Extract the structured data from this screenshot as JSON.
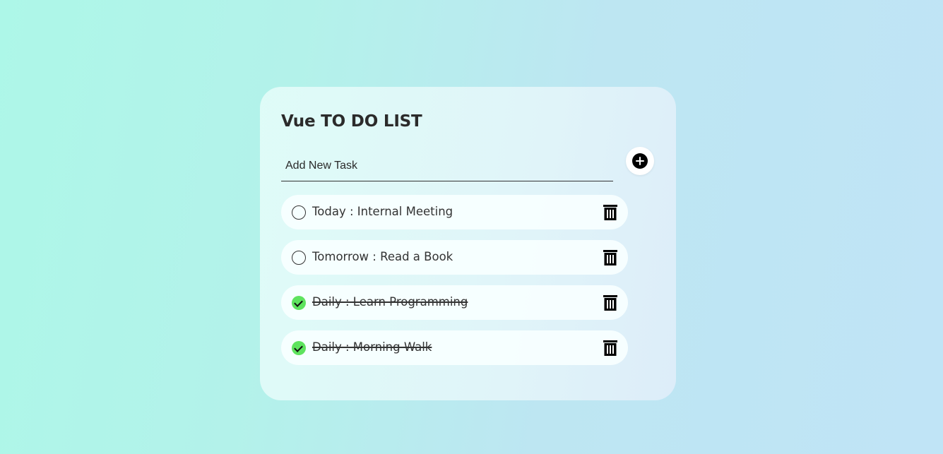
{
  "app": {
    "title": "Vue TO DO LIST"
  },
  "new_task": {
    "placeholder": "Add New Task",
    "value": "",
    "add_icon": "plus-circle-icon"
  },
  "tasks": [
    {
      "text": "Today : Internal Meeting",
      "completed": false,
      "delete_icon": "trash-icon"
    },
    {
      "text": "Tomorrow : Read a Book",
      "completed": false,
      "delete_icon": "trash-icon"
    },
    {
      "text": "Daily : Learn Programming",
      "completed": true,
      "delete_icon": "trash-icon"
    },
    {
      "text": "Daily : Morning Walk",
      "completed": true,
      "delete_icon": "trash-icon"
    }
  ],
  "colors": {
    "completed_check": "#5ee35e",
    "background_start": "#adf7e8",
    "background_end": "#c0e4f6"
  }
}
